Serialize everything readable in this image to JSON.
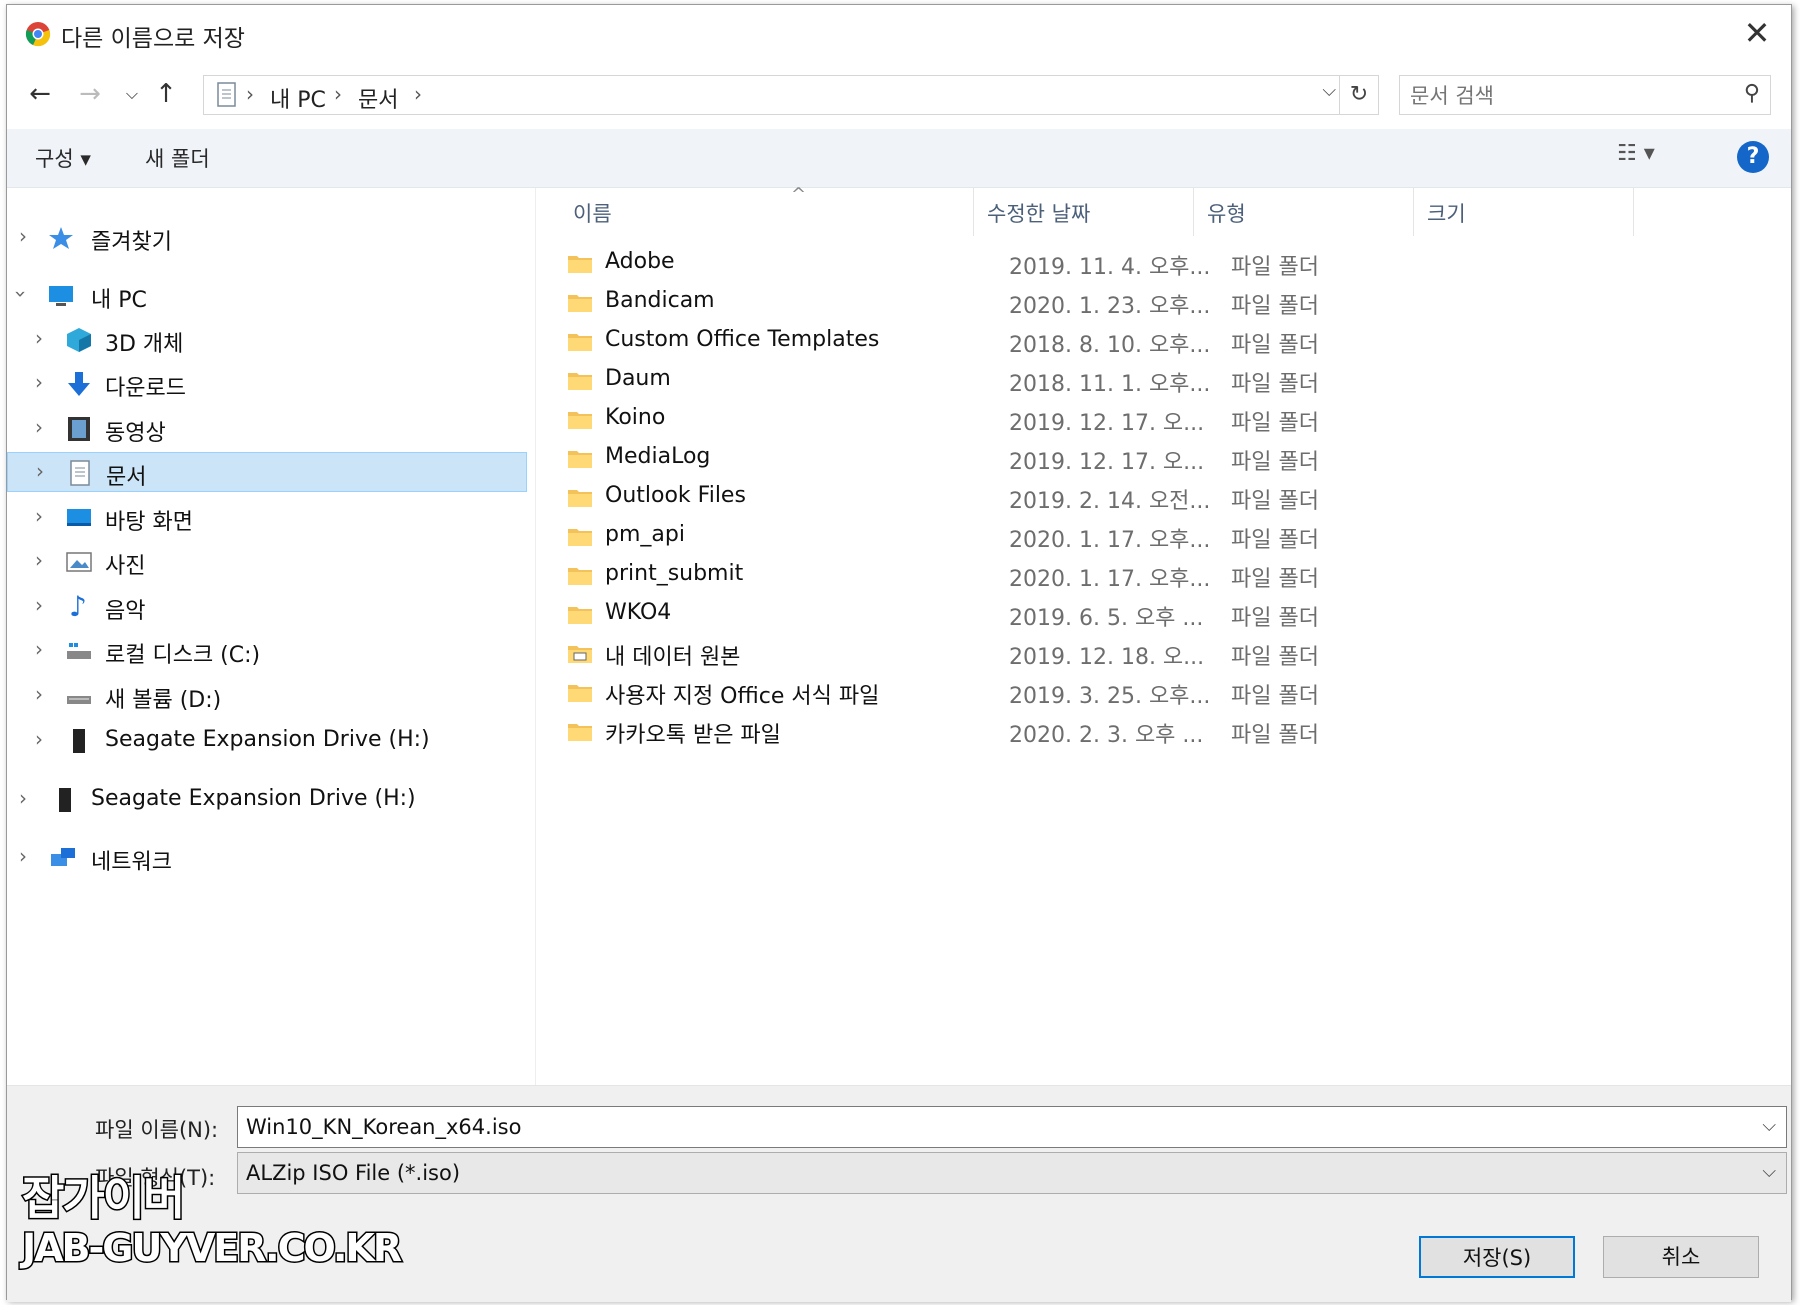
{
  "window": {
    "title": "다른 이름으로 저장",
    "close": "✕"
  },
  "nav": {
    "breadcrumbs": [
      "내 PC",
      "문서"
    ],
    "search_placeholder": "문서 검색"
  },
  "toolbar": {
    "organize": "구성 ▾",
    "new_folder": "새 폴더",
    "help": "?"
  },
  "tree": [
    {
      "label": "즐겨찾기",
      "icon": "star-icon"
    },
    {
      "label": "내 PC",
      "icon": "computer-icon"
    },
    {
      "label": "3D 개체",
      "icon": "cube-icon"
    },
    {
      "label": "다운로드",
      "icon": "download-arrow-icon"
    },
    {
      "label": "동영상",
      "icon": "film-icon"
    },
    {
      "label": "문서",
      "icon": "document-icon"
    },
    {
      "label": "바탕 화면",
      "icon": "desktop-icon"
    },
    {
      "label": "사진",
      "icon": "picture-icon"
    },
    {
      "label": "음악",
      "icon": "music-note-icon"
    },
    {
      "label": "로컬 디스크 (C:)",
      "icon": "drive-icon"
    },
    {
      "label": "새 볼륨 (D:)",
      "icon": "drive-icon"
    },
    {
      "label": "Seagate Expansion Drive (H:)",
      "icon": "external-drive-icon"
    },
    {
      "label": "Seagate Expansion Drive (H:)",
      "icon": "external-drive-icon"
    },
    {
      "label": "네트워크",
      "icon": "network-icon"
    }
  ],
  "columns": {
    "name": "이름",
    "date": "수정한 날짜",
    "type": "유형",
    "size": "크기"
  },
  "files": [
    {
      "name": "Adobe",
      "date": "2019. 11. 4. 오후...",
      "type": "파일 폴더"
    },
    {
      "name": "Bandicam",
      "date": "2020. 1. 23. 오후...",
      "type": "파일 폴더"
    },
    {
      "name": "Custom Office Templates",
      "date": "2018. 8. 10. 오후...",
      "type": "파일 폴더"
    },
    {
      "name": "Daum",
      "date": "2018. 11. 1. 오후...",
      "type": "파일 폴더"
    },
    {
      "name": "Koino",
      "date": "2019. 12. 17. 오...",
      "type": "파일 폴더"
    },
    {
      "name": "MediaLog",
      "date": "2019. 12. 17. 오...",
      "type": "파일 폴더"
    },
    {
      "name": "Outlook Files",
      "date": "2019. 2. 14. 오전...",
      "type": "파일 폴더"
    },
    {
      "name": "pm_api",
      "date": "2020. 1. 17. 오후...",
      "type": "파일 폴더"
    },
    {
      "name": "print_submit",
      "date": "2020. 1. 17. 오후...",
      "type": "파일 폴더"
    },
    {
      "name": "WKO4",
      "date": "2019. 6. 5. 오후 ...",
      "type": "파일 폴더"
    },
    {
      "name": "내 데이터 원본",
      "date": "2019. 12. 18. 오...",
      "type": "파일 폴더"
    },
    {
      "name": "사용자 지정 Office 서식 파일",
      "date": "2019. 3. 25. 오후...",
      "type": "파일 폴더"
    },
    {
      "name": "카카오톡 받은 파일",
      "date": "2020. 2. 3. 오후 ...",
      "type": "파일 폴더"
    }
  ],
  "bottom": {
    "filename_label": "파일 이름(N):",
    "filename_value": "Win10_KN_Korean_x64.iso",
    "filetype_label": "파일 형식(T):",
    "filetype_value": "ALZip ISO File (*.iso)",
    "save": "저장(S)",
    "cancel": "취소"
  },
  "watermark": {
    "line1": "잡가이버",
    "line2": "JAB-GUYVER.CO.KR"
  }
}
